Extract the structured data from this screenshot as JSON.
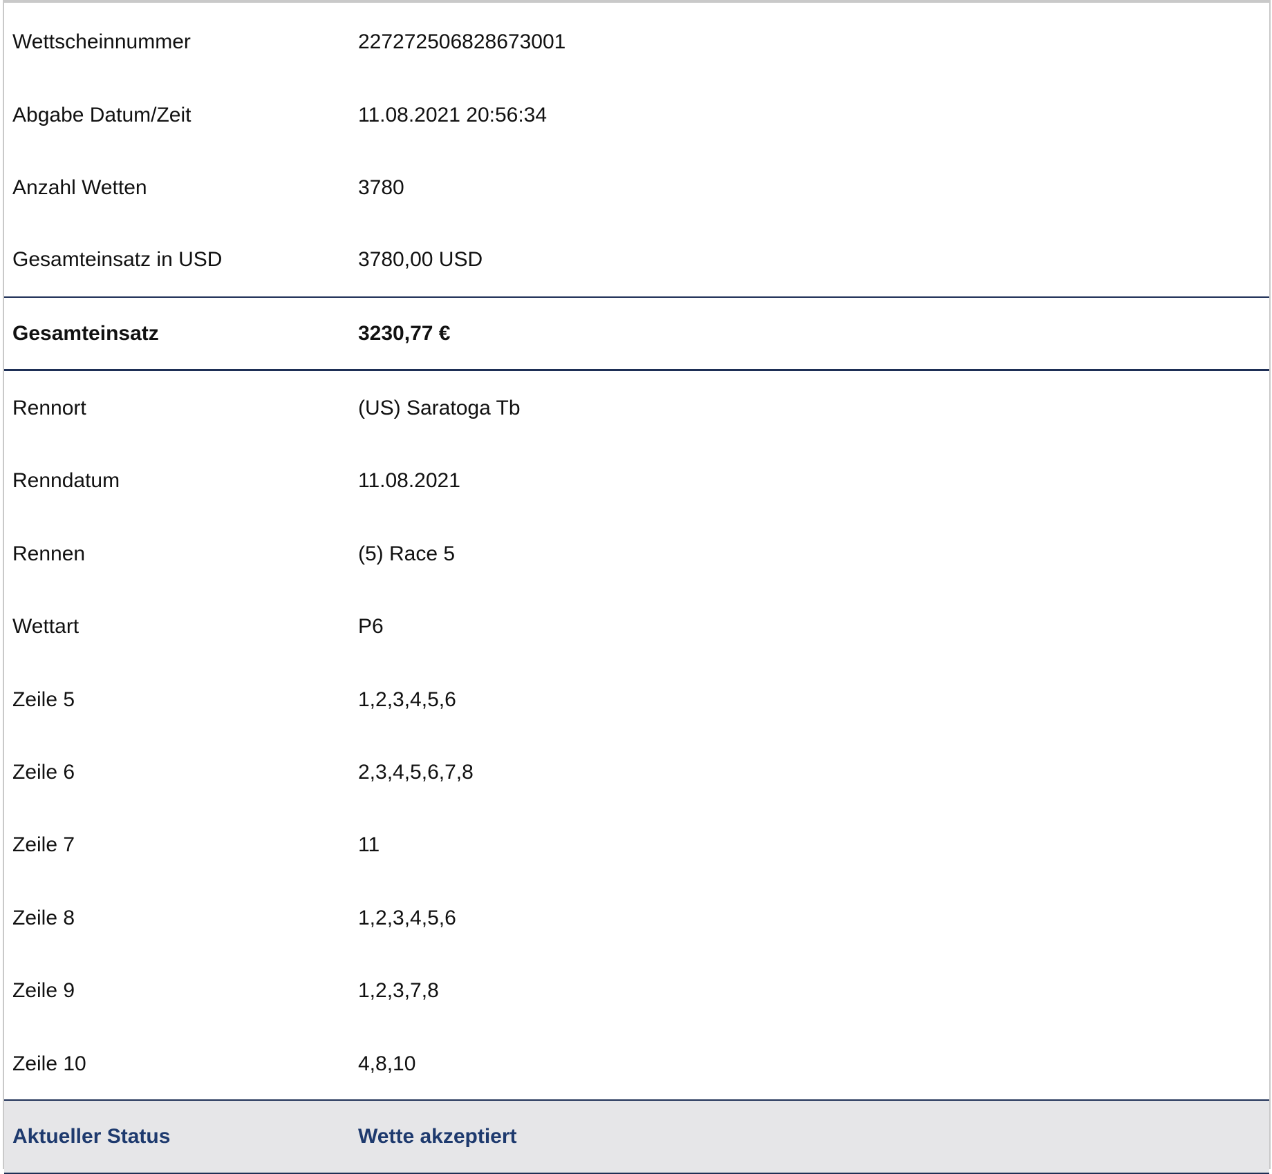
{
  "ticket": {
    "summary_rows": [
      {
        "label": "Wettscheinnummer",
        "value": "227272506828673001"
      },
      {
        "label": "Abgabe Datum/Zeit",
        "value": "11.08.2021 20:56:34"
      },
      {
        "label": "Anzahl Wetten",
        "value": "3780"
      },
      {
        "label": "Gesamteinsatz in USD",
        "value": "3780,00 USD"
      }
    ],
    "total": {
      "label": "Gesamteinsatz",
      "value": "3230,77 €"
    },
    "detail_rows": [
      {
        "label": "Rennort",
        "value": "(US) Saratoga Tb"
      },
      {
        "label": "Renndatum",
        "value": "11.08.2021"
      },
      {
        "label": "Rennen",
        "value": "(5) Race 5"
      },
      {
        "label": "Wettart",
        "value": "P6"
      },
      {
        "label": "Zeile 5",
        "value": "1,2,3,4,5,6"
      },
      {
        "label": "Zeile 6",
        "value": "2,3,4,5,6,7,8"
      },
      {
        "label": "Zeile 7",
        "value": "11"
      },
      {
        "label": "Zeile 8",
        "value": "1,2,3,4,5,6"
      },
      {
        "label": "Zeile 9",
        "value": "1,2,3,7,8"
      },
      {
        "label": "Zeile 10",
        "value": "4,8,10"
      }
    ],
    "status": {
      "label": "Aktueller Status",
      "value": "Wette akzeptiert"
    },
    "colors": {
      "accent": "#1e3a6e",
      "divider": "#1e2f56",
      "status_background": "#e6e6e8"
    }
  }
}
